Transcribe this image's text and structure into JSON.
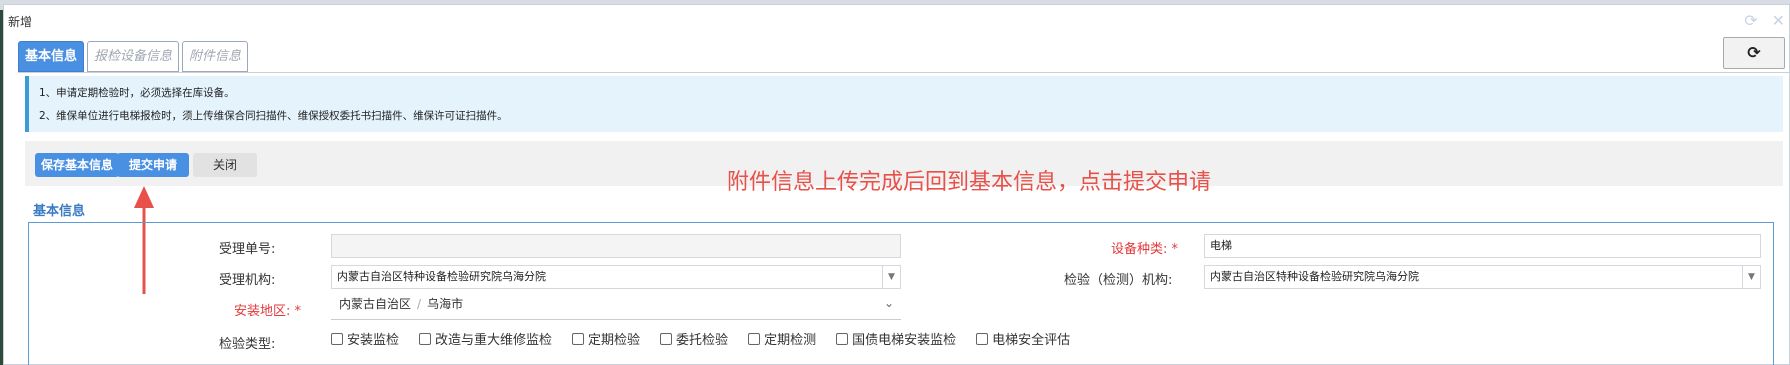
{
  "dialog": {
    "title": "新增"
  },
  "tabs": [
    {
      "label": "基本信息",
      "active": true
    },
    {
      "label": "报检设备信息",
      "active": false
    },
    {
      "label": "附件信息",
      "active": false
    }
  ],
  "refresh_icon": "⟳",
  "notice": {
    "line1": "1、申请定期检验时，必须选择在库设备。",
    "line2": "2、维保单位进行电梯报检时，须上传维保合同扫描件、维保授权委托书扫描件、维保许可证扫描件。"
  },
  "toolbar": {
    "save_label": "保存基本信息",
    "submit_label": "提交申请",
    "close_label": "关闭"
  },
  "annotation": {
    "hint": "附件信息上传完成后回到基本信息，点击提交申请",
    "color": "#e8514a"
  },
  "section": {
    "title": "基本信息"
  },
  "form": {
    "accept_no_label": "受理单号:",
    "accept_no_value": "",
    "device_type_label": "设备种类:",
    "device_type_value": "电梯",
    "accept_org_label": "受理机构:",
    "accept_org_value": "内蒙古自治区特种设备检验研究院乌海分院",
    "inspect_org_label": "检验（检测）机构:",
    "inspect_org_value": "内蒙古自治区特种设备检验研究院乌海分院",
    "install_area_label": "安装地区:",
    "install_area_province": "内蒙古自治区",
    "install_area_separator": "/",
    "install_area_city": "乌海市",
    "inspect_type_label": "检验类型:",
    "inspect_types": [
      "安装监检",
      "改造与重大维修监检",
      "定期检验",
      "委托检验",
      "定期检测",
      "国债电梯安装监检",
      "电梯安全评估"
    ],
    "required_mark": "*"
  },
  "colors": {
    "primary": "#4a90e2",
    "required": "#e03a3a",
    "notice_bg": "#e4f3fc"
  }
}
